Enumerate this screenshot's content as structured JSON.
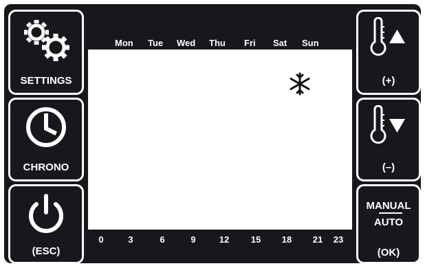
{
  "left_buttons": [
    {
      "id": "settings",
      "label": "SETTINGS",
      "icon": "gears-icon"
    },
    {
      "id": "chrono",
      "label": "CHRONO",
      "icon": "clock-icon"
    },
    {
      "id": "esc",
      "label": "(ESC)",
      "icon": "power-icon"
    }
  ],
  "right_buttons": [
    {
      "id": "temp-up",
      "label": "(+)",
      "icon": "thermometer-up-icon"
    },
    {
      "id": "temp-down",
      "label": "(–)",
      "icon": "thermometer-down-icon"
    },
    {
      "id": "mode",
      "label_top": "MANUAL",
      "label_bottom": "AUTO",
      "label": "(OK)"
    }
  ],
  "days": [
    "Mon",
    "Tue",
    "Wed",
    "Thu",
    "Fri",
    "Sat",
    "Sun"
  ],
  "hours": [
    "0",
    "3",
    "6",
    "9",
    "12",
    "15",
    "18",
    "21",
    "23"
  ],
  "display": {
    "mode_icon": "snowflake-icon"
  },
  "colors": {
    "panel": "#16181c",
    "screen": "#ffffff",
    "text": "#ffffff"
  }
}
